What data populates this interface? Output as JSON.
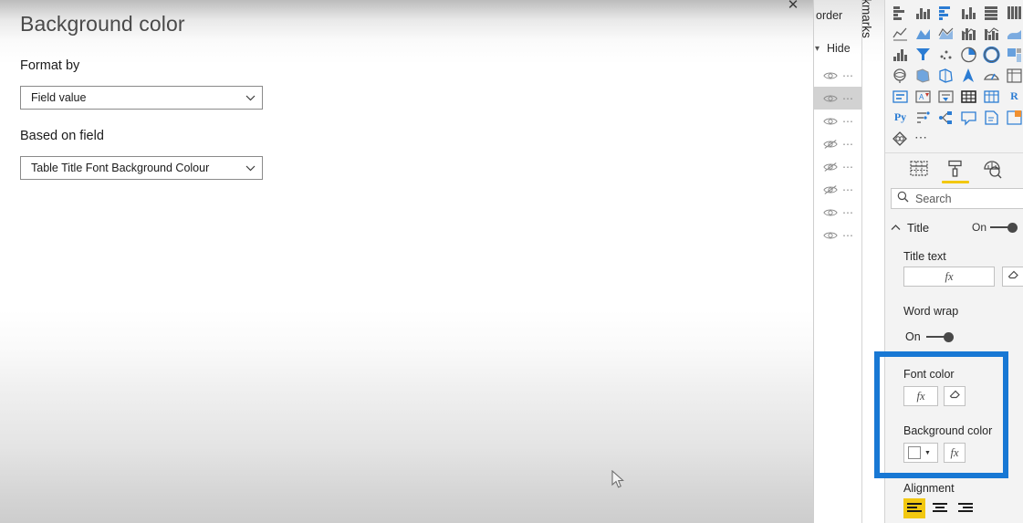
{
  "dialog": {
    "title": "Background color",
    "close_label": "✕",
    "format_by": {
      "label": "Format by",
      "value": "Field value"
    },
    "based_on_field": {
      "label": "Based on field",
      "value": "Table Title Font Background Colour"
    }
  },
  "selection_pane": {
    "header_order": "order",
    "header_hide": "Hide",
    "rows": [
      {
        "visible": true,
        "menu": "⋯",
        "selected": false
      },
      {
        "visible": true,
        "menu": "⋯",
        "selected": true
      },
      {
        "visible": true,
        "menu": "⋯",
        "selected": false
      },
      {
        "visible": false,
        "menu": "⋯",
        "selected": false
      },
      {
        "visible": false,
        "menu": "⋯",
        "selected": false
      },
      {
        "visible": false,
        "menu": "⋯",
        "selected": false
      },
      {
        "visible": true,
        "menu": "⋯",
        "selected": false
      },
      {
        "visible": true,
        "menu": "⋯",
        "selected": false
      }
    ]
  },
  "bookmarks_tab": {
    "label": "Bookmarks"
  },
  "visualizations": {
    "more_label": "⋯",
    "icons": [
      "stacked-bar-chart-icon",
      "stacked-column-chart-icon",
      "clustered-bar-chart-icon",
      "clustered-column-chart-icon",
      "hundred-percent-stacked-bar-chart-icon",
      "hundred-percent-stacked-column-chart-icon",
      "line-chart-icon",
      "area-chart-icon",
      "stacked-area-chart-icon",
      "line-and-stacked-column-chart-icon",
      "line-and-clustered-column-chart-icon",
      "ribbon-chart-icon",
      "waterfall-chart-icon",
      "funnel-chart-icon",
      "scatter-chart-icon",
      "pie-chart-icon",
      "donut-chart-icon",
      "treemap-icon",
      "map-icon",
      "filled-map-icon",
      "shape-map-icon",
      "azure-map-icon",
      "gauge-icon",
      "matrix-icon",
      "card-icon",
      "multi-row-card-icon",
      "kpi-icon",
      "slicer-icon",
      "table-icon",
      "matrix-table-icon",
      "r-script-visual-icon",
      "python-visual-icon",
      "key-influencers-icon",
      "decomposition-tree-icon",
      "q-and-a-icon",
      "smart-narrative-icon",
      "paginated-report-icon",
      "get-more-visuals-icon"
    ],
    "tabs": [
      {
        "name": "build-tab",
        "selected": false
      },
      {
        "name": "format-tab",
        "selected": true
      },
      {
        "name": "analytics-tab",
        "selected": false
      }
    ],
    "search": {
      "placeholder": "Search"
    },
    "sections": {
      "title": {
        "name": "Title",
        "toggle_state": "On",
        "title_text": {
          "label": "Title text",
          "fx_label": "fx",
          "reset_icon": "eraser-icon"
        },
        "word_wrap": {
          "label": "Word wrap",
          "state": "On"
        },
        "font_color": {
          "label": "Font color",
          "fx_label": "fx",
          "reset_icon": "eraser-icon"
        },
        "background_color": {
          "label": "Background color",
          "swatch": "#ffffff",
          "fx_label": "fx"
        },
        "alignment": {
          "label": "Alignment",
          "options": [
            "align-left",
            "align-center",
            "align-right"
          ],
          "selected": 0
        }
      }
    }
  },
  "colors": {
    "highlight_blue": "#1878d4",
    "accent_yellow": "#f2c811",
    "viz_icon_blue": "#2b7cd3"
  }
}
